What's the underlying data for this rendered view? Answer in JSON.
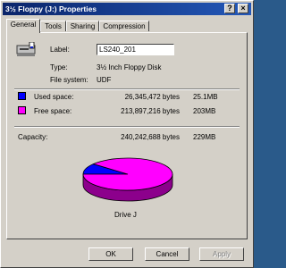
{
  "window": {
    "title": "3½ Floppy (J:) Properties",
    "help_label": "?",
    "close_label": "×"
  },
  "tabs": [
    {
      "label": "General",
      "active": true
    },
    {
      "label": "Tools",
      "active": false
    },
    {
      "label": "Sharing",
      "active": false
    },
    {
      "label": "Compression",
      "active": false
    }
  ],
  "general": {
    "label_caption": "Label:",
    "label_value": "LS240_201",
    "type_caption": "Type:",
    "type_value": "3½ Inch Floppy Disk",
    "fs_caption": "File system:",
    "fs_value": "UDF",
    "used": {
      "caption": "Used space:",
      "bytes": "26,345,472 bytes",
      "size": "25.1MB",
      "color": "#0000ff"
    },
    "free": {
      "caption": "Free space:",
      "bytes": "213,897,216 bytes",
      "size": "203MB",
      "color": "#ff00ff"
    },
    "capacity": {
      "caption": "Capacity:",
      "bytes": "240,242,688 bytes",
      "size": "229MB"
    },
    "drive_label": "Drive J"
  },
  "chart_data": {
    "type": "pie",
    "slices": [
      {
        "name": "Used space",
        "value": 26345472,
        "color": "#0000ff"
      },
      {
        "name": "Free space",
        "value": 213897216,
        "color": "#ff00ff"
      }
    ]
  },
  "buttons": {
    "ok": "OK",
    "cancel": "Cancel",
    "apply": "Apply"
  }
}
